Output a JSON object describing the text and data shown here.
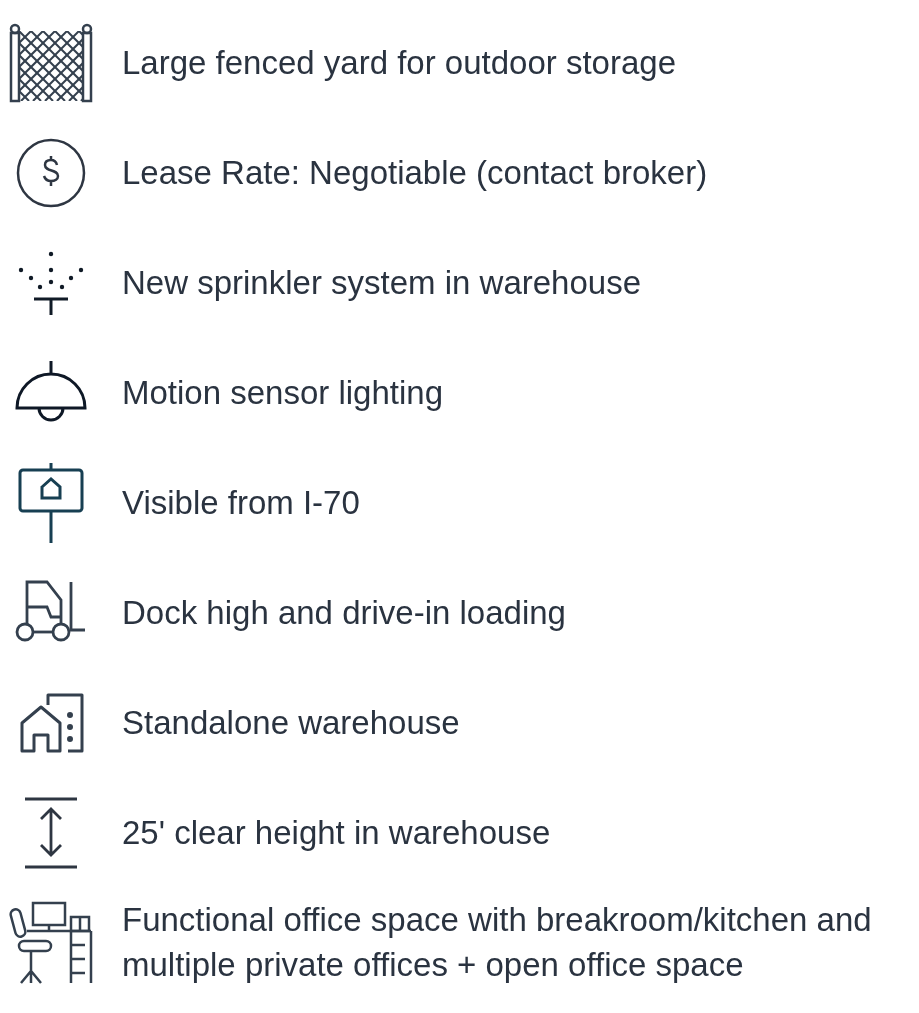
{
  "features": [
    {
      "kind": "fence",
      "text": "Large fenced yard for outdoor storage"
    },
    {
      "kind": "dollar",
      "text": "Lease Rate:  Negotiable (contact broker)"
    },
    {
      "kind": "sprinkler",
      "text": "New sprinkler system in warehouse"
    },
    {
      "kind": "lamp",
      "text": "Motion sensor lighting"
    },
    {
      "kind": "sign",
      "text": "Visible from I-70"
    },
    {
      "kind": "forklift",
      "text": "Dock high and drive-in loading"
    },
    {
      "kind": "building",
      "text": "Standalone warehouse"
    },
    {
      "kind": "height",
      "text": "25' clear height in warehouse"
    },
    {
      "kind": "office",
      "text": "Functional office space with breakroom/kitchen and multiple private offices + open office space"
    }
  ]
}
